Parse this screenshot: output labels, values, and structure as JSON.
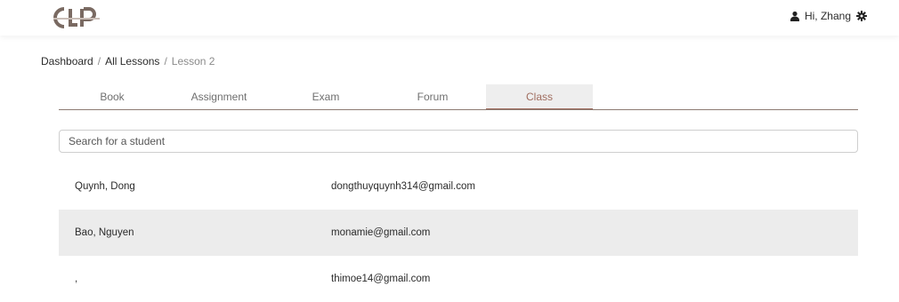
{
  "header": {
    "user_greeting": "Hi, Zhang"
  },
  "breadcrumb": {
    "items": [
      "Dashboard",
      "All Lessons"
    ],
    "current": "Lesson 2"
  },
  "tabs": [
    {
      "label": "Book"
    },
    {
      "label": "Assignment"
    },
    {
      "label": "Exam"
    },
    {
      "label": "Forum"
    },
    {
      "label": "Class",
      "active": true
    }
  ],
  "search": {
    "placeholder": "Search for a student",
    "value": ""
  },
  "students": [
    {
      "name": "Quynh, Dong",
      "email": "dongthuyquynh314@gmail.com"
    },
    {
      "name": "Bao, Nguyen",
      "email": "monamie@gmail.com"
    },
    {
      "name": ",",
      "email": "thimoe14@gmail.com"
    }
  ],
  "colors": {
    "accent": "#a06d5f",
    "tab_active_bg": "#eeeeee",
    "row_alt_bg": "#ececec"
  },
  "icons": {
    "logo": "brand-logo",
    "user": "user-icon",
    "settings": "gear-icon"
  }
}
